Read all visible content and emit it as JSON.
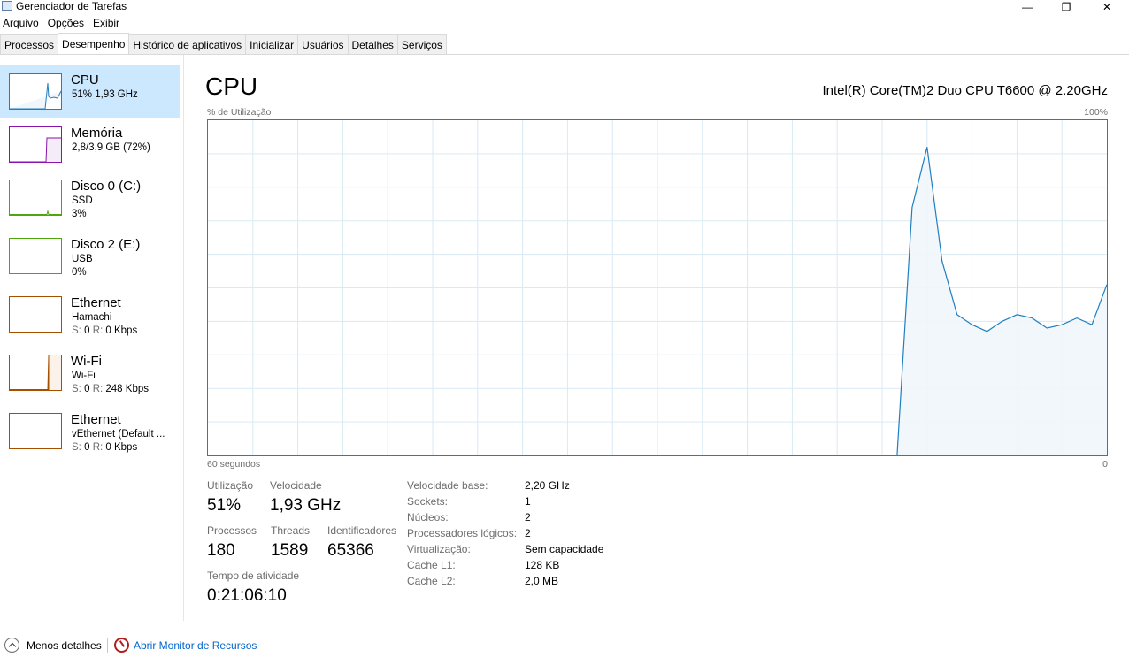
{
  "window": {
    "title": "Gerenciador de Tarefas",
    "minimize_glyph": "—",
    "maximize_glyph": "❐",
    "close_glyph": "✕"
  },
  "menu": [
    "Arquivo",
    "Opções",
    "Exibir"
  ],
  "tabs": [
    "Processos",
    "Desempenho",
    "Histórico de aplicativos",
    "Inicializar",
    "Usuários",
    "Detalhes",
    "Serviços"
  ],
  "active_tab": "Desempenho",
  "sidebar": {
    "items": [
      {
        "name": "CPU",
        "line1": "51% 1,93 GHz",
        "line2": "",
        "color": "#1f7fc0",
        "icon": "cpu-graph-icon",
        "selected": true
      },
      {
        "name": "Memória",
        "line1": "2,8/3,9 GB (72%)",
        "line2": "",
        "color": "#8b12ae",
        "icon": "memory-graph-icon",
        "selected": false
      },
      {
        "name": "Disco 0 (C:)",
        "line1": "SSD",
        "line2": "3%",
        "color": "#4da60c",
        "icon": "disk-graph-icon",
        "selected": false
      },
      {
        "name": "Disco 2 (E:)",
        "line1": "USB",
        "line2": "0%",
        "color": "#4da60c",
        "icon": "disk-graph-icon",
        "selected": false
      },
      {
        "name": "Ethernet",
        "line1": "Hamachi",
        "line2_label": "S:",
        "line2_s": "0",
        "line2_r_label": "R:",
        "line2_r": "0 Kbps",
        "color": "#a74f01",
        "icon": "network-graph-icon",
        "selected": false
      },
      {
        "name": "Wi-Fi",
        "line1": "Wi-Fi",
        "line2_label": "S:",
        "line2_s": "0",
        "line2_r_label": "R:",
        "line2_r": "248 Kbps",
        "color": "#a74f01",
        "icon": "network-graph-icon",
        "selected": false
      },
      {
        "name": "Ethernet",
        "line1": "vEthernet (Default ...",
        "line2_label": "S:",
        "line2_s": "0",
        "line2_r_label": "R:",
        "line2_r": "0 Kbps",
        "color": "#a74f01",
        "icon": "network-graph-icon",
        "selected": false
      }
    ]
  },
  "main": {
    "title": "CPU",
    "model": "Intel(R) Core(TM)2 Duo CPU T6600 @ 2.20GHz",
    "graph_label_left": "% de Utilização",
    "graph_label_right": "100%",
    "time_left": "60 segundos",
    "time_right": "0",
    "stats": {
      "util_label": "Utilização",
      "util_value": "51%",
      "speed_label": "Velocidade",
      "speed_value": "1,93 GHz",
      "proc_label": "Processos",
      "proc_value": "180",
      "threads_label": "Threads",
      "threads_value": "1589",
      "handles_label": "Identificadores",
      "handles_value": "65366",
      "uptime_label": "Tempo de atividade",
      "uptime_value": "0:21:06:10"
    },
    "details": [
      {
        "key": "Velocidade base:",
        "value": "2,20 GHz"
      },
      {
        "key": "Sockets:",
        "value": "1"
      },
      {
        "key": "Núcleos:",
        "value": "2"
      },
      {
        "key": "Processadores lógicos:",
        "value": "2"
      },
      {
        "key": "Virtualização:",
        "value": "Sem capacidade"
      },
      {
        "key": "Cache L1:",
        "value": "128 KB"
      },
      {
        "key": "Cache L2:",
        "value": "2,0 MB"
      }
    ]
  },
  "chart_data": {
    "type": "area",
    "x_label": "60 segundos",
    "y_range": [
      0,
      100
    ],
    "x_range_seconds": [
      60,
      0
    ],
    "grid": true,
    "color": "#1f7fc0",
    "fill": "#f1f6fb",
    "series": [
      {
        "x_seconds_ago": [
          60,
          59,
          58,
          57,
          56,
          55,
          54,
          53,
          52,
          51,
          50,
          49,
          48,
          47,
          46,
          45,
          44,
          43,
          42,
          41,
          40,
          39,
          38,
          37,
          36,
          35,
          34,
          33,
          32,
          31,
          30,
          29,
          28,
          27,
          26,
          25,
          24,
          23,
          22,
          21,
          20,
          19,
          18,
          17,
          16,
          15,
          14,
          13,
          12,
          11,
          10,
          9,
          8,
          7,
          6,
          5,
          4,
          3,
          2,
          1,
          0
        ],
        "values": [
          0,
          0,
          0,
          0,
          0,
          0,
          0,
          0,
          0,
          0,
          0,
          0,
          0,
          0,
          0,
          0,
          0,
          0,
          0,
          0,
          0,
          0,
          0,
          0,
          0,
          0,
          0,
          0,
          0,
          0,
          0,
          0,
          0,
          0,
          0,
          0,
          0,
          0,
          0,
          0,
          0,
          0,
          0,
          0,
          0,
          0,
          0,
          74,
          92,
          58,
          42,
          39,
          37,
          40,
          42,
          41,
          38,
          39,
          41,
          39,
          51
        ]
      }
    ]
  },
  "footer": {
    "less_details": "Menos detalhes",
    "resource_monitor": "Abrir Monitor de Recursos"
  }
}
